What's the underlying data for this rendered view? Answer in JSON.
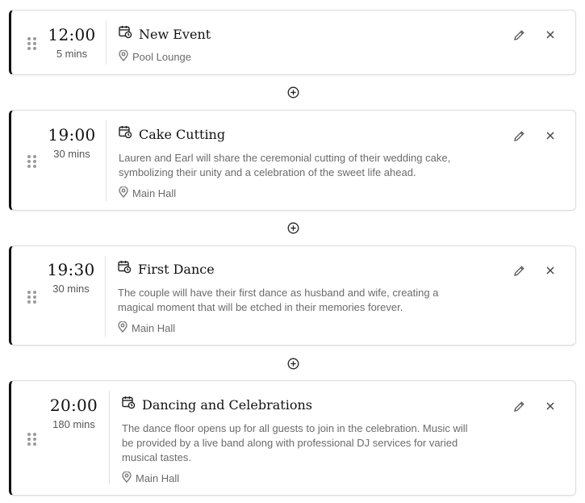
{
  "events": [
    {
      "time": "12:00",
      "duration": "5 mins",
      "title": "New Event",
      "description": "",
      "location": "Pool Lounge"
    },
    {
      "time": "19:00",
      "duration": "30 mins",
      "title": "Cake Cutting",
      "description": "Lauren and Earl will share the ceremonial cutting of their wedding cake, symbolizing their unity and a celebration of the sweet life ahead.",
      "location": "Main Hall"
    },
    {
      "time": "19:30",
      "duration": "30 mins",
      "title": "First Dance",
      "description": "The couple will have their first dance as husband and wife, creating a magical moment that will be etched in their memories forever.",
      "location": "Main Hall"
    },
    {
      "time": "20:00",
      "duration": "180 mins",
      "title": "Dancing and Celebrations",
      "description": "The dance floor opens up for all guests to join in the celebration. Music will be provided by a live band along with professional DJ services for varied musical tastes.",
      "location": "Main Hall"
    }
  ],
  "icons": {
    "event": "calendar-clock-icon",
    "location": "map-pin-icon",
    "edit": "pencil-icon",
    "delete": "close-icon",
    "add": "plus-circle-icon",
    "drag": "drag-handle-icon"
  }
}
